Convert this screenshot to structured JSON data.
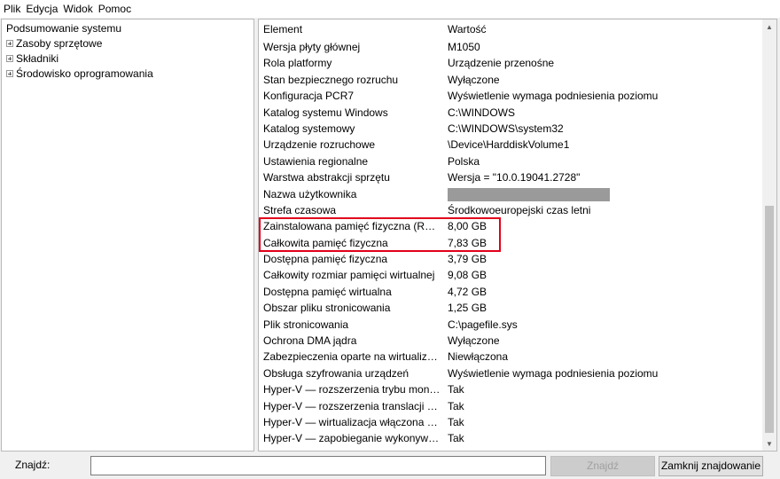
{
  "menu": [
    "Plik",
    "Edycja",
    "Widok",
    "Pomoc"
  ],
  "tree": {
    "root": "Podsumowanie systemu",
    "children": [
      "Zasoby sprzętowe",
      "Składniki",
      "Środowisko oprogramowania"
    ]
  },
  "list": {
    "headers": [
      "Element",
      "Wartość"
    ],
    "rows": [
      {
        "element": "Wersja płyty głównej",
        "value": "M1050"
      },
      {
        "element": "Rola platformy",
        "value": "Urządzenie przenośne"
      },
      {
        "element": "Stan bezpiecznego rozruchu",
        "value": "Wyłączone"
      },
      {
        "element": "Konfiguracja PCR7",
        "value": "Wyświetlenie wymaga podniesienia poziomu"
      },
      {
        "element": "Katalog systemu Windows",
        "value": "C:\\WINDOWS"
      },
      {
        "element": "Katalog systemowy",
        "value": "C:\\WINDOWS\\system32"
      },
      {
        "element": "Urządzenie rozruchowe",
        "value": "\\Device\\HarddiskVolume1"
      },
      {
        "element": "Ustawienia regionalne",
        "value": "Polska"
      },
      {
        "element": "Warstwa abstrakcji sprzętu",
        "value": "Wersja = \"10.0.19041.2728\""
      },
      {
        "element": "Nazwa użytkownika",
        "value": ""
      },
      {
        "element": "Strefa czasowa",
        "value": "Środkowoeuropejski czas letni"
      },
      {
        "element": "Zainstalowana pamięć fizyczna (RAM)",
        "value": "8,00 GB"
      },
      {
        "element": "Całkowita pamięć fizyczna",
        "value": "7,83 GB"
      },
      {
        "element": "Dostępna pamięć fizyczna",
        "value": "3,79 GB"
      },
      {
        "element": "Całkowity rozmiar pamięci wirtualnej",
        "value": "9,08 GB"
      },
      {
        "element": "Dostępna pamięć wirtualna",
        "value": "4,72 GB"
      },
      {
        "element": "Obszar pliku stronicowania",
        "value": "1,25 GB"
      },
      {
        "element": "Plik stronicowania",
        "value": "C:\\pagefile.sys"
      },
      {
        "element": "Ochrona DMA jądra",
        "value": "Wyłączone"
      },
      {
        "element": "Zabezpieczenia oparte na wirtualizacji",
        "value": "Niewłączona"
      },
      {
        "element": "Obsługa szyfrowania urządzeń",
        "value": "Wyświetlenie wymaga podniesienia poziomu"
      },
      {
        "element": "Hyper-V — rozszerzenia trybu monitor...",
        "value": "Tak"
      },
      {
        "element": "Hyper-V — rozszerzenia translacji adre...",
        "value": "Tak"
      },
      {
        "element": "Hyper-V — wirtualizacja włączona w o...",
        "value": "Tak"
      },
      {
        "element": "Hyper-V — zapobieganie wykonywani...",
        "value": "Tak"
      }
    ]
  },
  "find": {
    "label": "Znajdź:",
    "value": "",
    "find_button": "Znajdź",
    "close_button": "Zamknij znajdowanie"
  },
  "colors": {
    "highlight": "#e2001a",
    "redaction": "#9a9a9a"
  }
}
